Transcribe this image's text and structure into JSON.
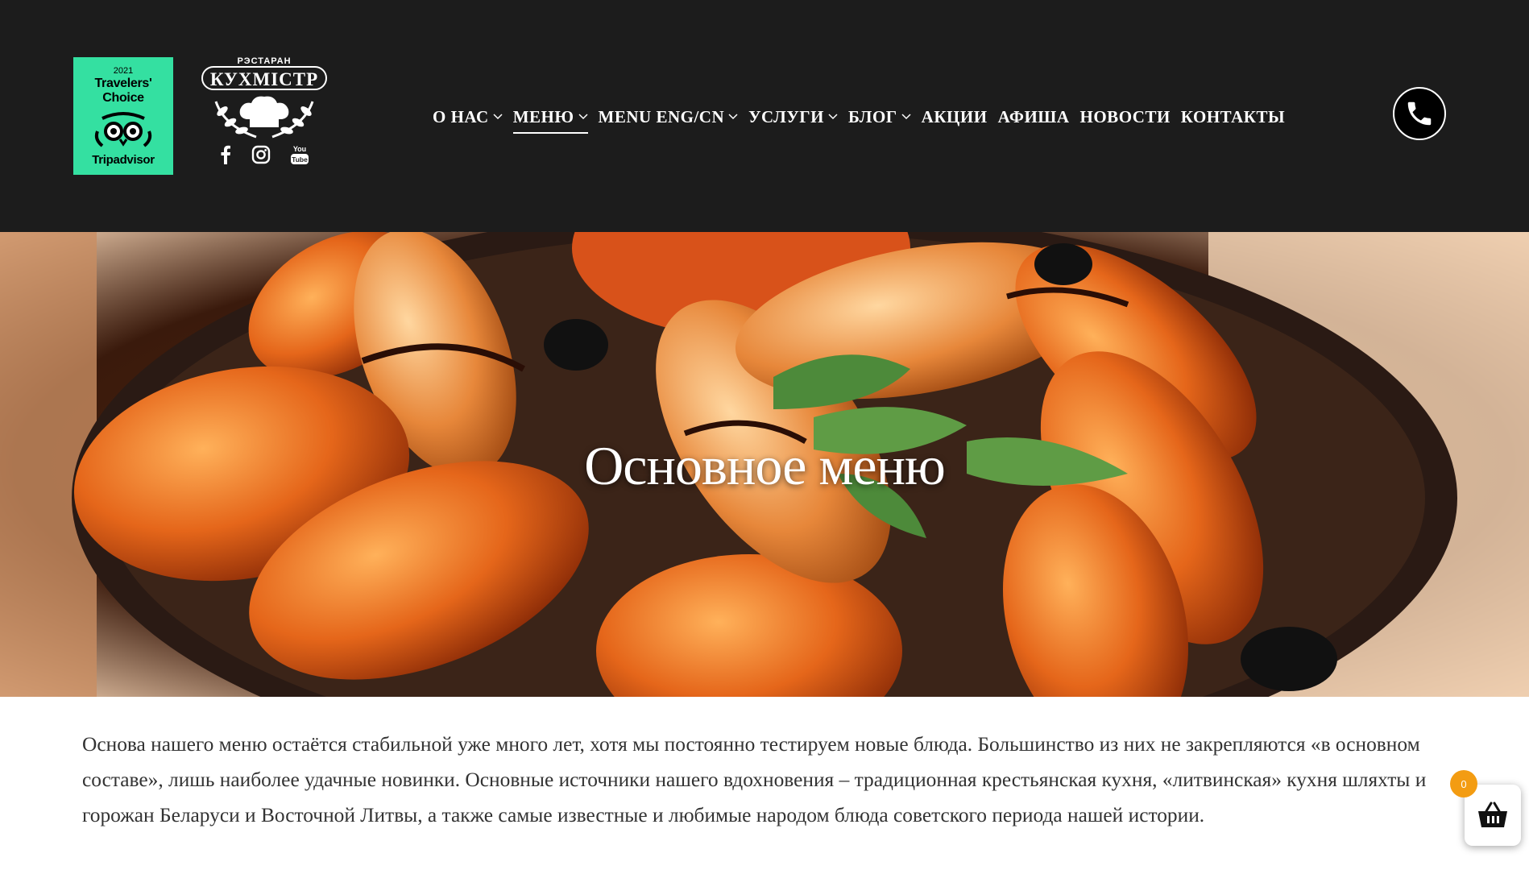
{
  "header": {
    "tripadvisor": {
      "year": "2021",
      "line1": "Travelers'",
      "line2": "Choice",
      "brand": "Tripadvisor",
      "color": "#34e0a1"
    },
    "logo": {
      "small_text": "РЭСТАРАН",
      "name": "КУХМІСТР"
    },
    "social": [
      {
        "name": "facebook-icon"
      },
      {
        "name": "instagram-icon"
      },
      {
        "name": "youtube-icon",
        "text_top": "You",
        "text_bottom": "Tube"
      }
    ],
    "nav": [
      {
        "label": "О НАС",
        "dropdown": true
      },
      {
        "label": "МЕНЮ",
        "dropdown": true,
        "active": true
      },
      {
        "label": "MENU ENG/CN",
        "dropdown": true
      },
      {
        "label": "УСЛУГИ",
        "dropdown": true
      },
      {
        "label": "БЛОГ",
        "dropdown": true
      },
      {
        "label": "АКЦИИ",
        "dropdown": false
      },
      {
        "label": "АФИША",
        "dropdown": false
      },
      {
        "label": "НОВОСТИ",
        "dropdown": false
      },
      {
        "label": "КОНТАКТЫ",
        "dropdown": false
      }
    ],
    "phone_icon": "phone-icon"
  },
  "hero": {
    "title": "Основное меню"
  },
  "intro": {
    "text": "Основа нашего меню остаётся стабильной уже много лет, хотя мы постоянно тестируем новые блюда. Большинство из них не закрепляются «в основном составе», лишь наиболее удачные новинки. Основные источники нашего вдохновения – традиционная крестьянская кухня, «литвинская» кухня шляхты и горожан Беларуси и Восточной Литвы, а также самые известные и любимые народом блюда советского периода нашей истории."
  },
  "cart": {
    "count": "0",
    "badge_color": "#f39c12",
    "icon": "basket-icon"
  }
}
